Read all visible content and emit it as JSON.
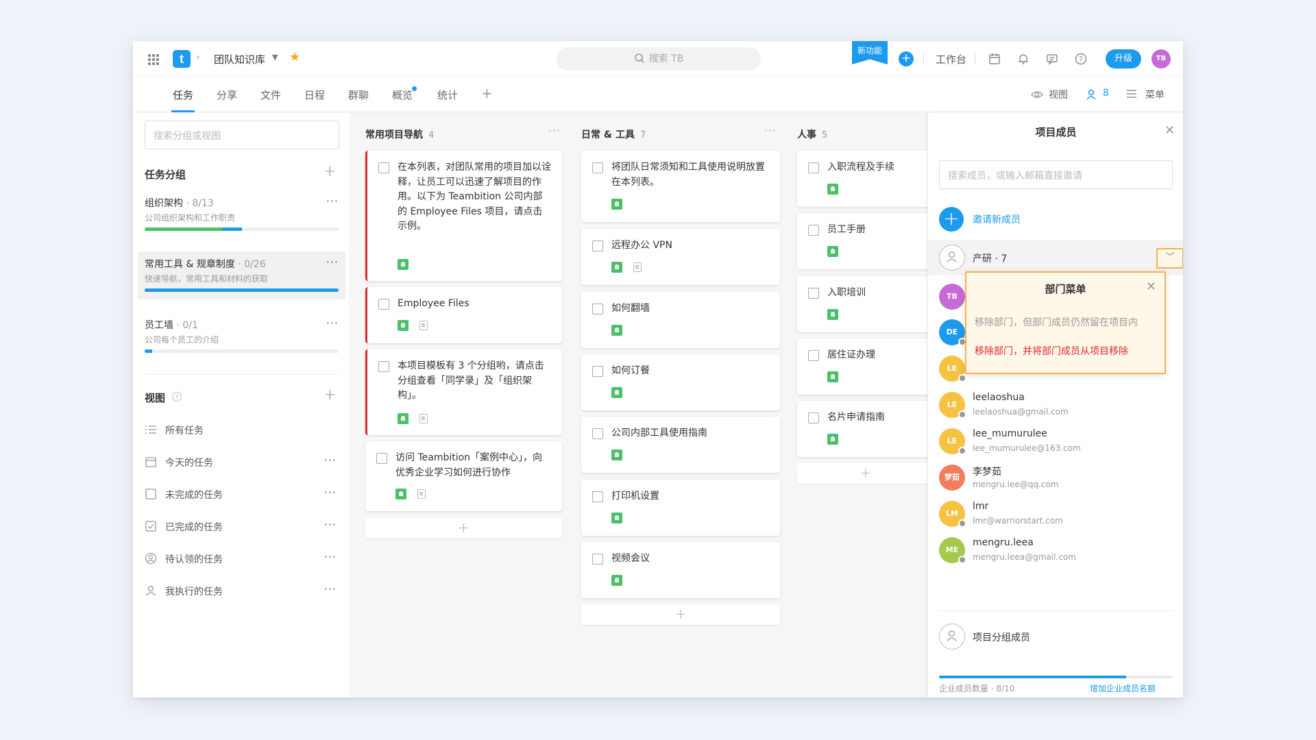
{
  "header": {
    "project_title": "团队知识库",
    "crumb_sep": "›",
    "search_placeholder": "搜索 TB",
    "new_feature": "新功能",
    "workbench": "工作台",
    "upgrade": "升级",
    "user_initials": "TB"
  },
  "tabs": [
    {
      "label": "任务"
    },
    {
      "label": "分享"
    },
    {
      "label": "文件"
    },
    {
      "label": "日程"
    },
    {
      "label": "群聊"
    },
    {
      "label": "概览"
    },
    {
      "label": "统计"
    }
  ],
  "tab_right": {
    "view": "视图",
    "members_count": "8",
    "menu": "菜单"
  },
  "sidebar": {
    "search_placeholder": "搜索分组或视图",
    "groups_title": "任务分组",
    "groups": [
      {
        "name": "组织架构",
        "count": "· 8/13",
        "desc": "公司组织架构和工作职责",
        "progress": 0.5
      },
      {
        "name": "常用工具 & 规章制度",
        "count": "· 0/26",
        "desc": "快速导航，常用工具和材料的获取",
        "progress": 1.0
      },
      {
        "name": "员工墙",
        "count": "· 0/1",
        "desc": "公司每个员工的介绍",
        "progress": 0.04
      }
    ],
    "views_title": "视图",
    "views": [
      {
        "label": "所有任务",
        "icon": "list-icon"
      },
      {
        "label": "今天的任务",
        "icon": "calendar-icon"
      },
      {
        "label": "未完成的任务",
        "icon": "checkbox-icon"
      },
      {
        "label": "已完成的任务",
        "icon": "checked-icon"
      },
      {
        "label": "待认领的任务",
        "icon": "user-circle-icon"
      },
      {
        "label": "我执行的任务",
        "icon": "user-icon"
      }
    ]
  },
  "board": {
    "columns": [
      {
        "title": "常用项目导航",
        "count": "4",
        "cards": [
          {
            "text": "在本列表，对团队常用的项目加以诠释，让员工可以迅速了解项目的作用。以下为 Teambition 公司内部的 Employee Files 项目，请点击示例。"
          },
          {
            "text": "Employee Files"
          },
          {
            "text": "本项目模板有 3 个分组哟，请点击分组查看「同学录」及「组织架构」。"
          },
          {
            "text": "访问 Teambition「案例中心」，向优秀企业学习如何进行协作"
          }
        ]
      },
      {
        "title": "日常 & 工具",
        "count": "7",
        "cards": [
          {
            "text": "将团队日常须知和工具使用说明放置在本列表。"
          },
          {
            "text": "远程办公 VPN"
          },
          {
            "text": "如何翻墙"
          },
          {
            "text": "如何订餐"
          },
          {
            "text": "公司内部工具使用指南"
          },
          {
            "text": "打印机设置"
          },
          {
            "text": "视频会议"
          }
        ]
      },
      {
        "title": "人事",
        "count": "5",
        "cards": [
          {
            "text": "入职流程及手续"
          },
          {
            "text": "员工手册"
          },
          {
            "text": "入职培训"
          },
          {
            "text": "居住证办理"
          },
          {
            "text": "名片申请指南"
          }
        ]
      }
    ]
  },
  "panel": {
    "title": "项目成员",
    "search_placeholder": "搜索成员，或输入邮箱直接邀请",
    "invite": "邀请新成员",
    "dept": "产研 · 7",
    "members": [
      {
        "initials": "TB",
        "color": "#c869d8",
        "name": "",
        "email": ""
      },
      {
        "initials": "DE",
        "color": "#1b9aee",
        "name": "",
        "email": ""
      },
      {
        "initials": "LE",
        "color": "#f5c242",
        "name": "",
        "email": ""
      },
      {
        "initials": "LE",
        "color": "#f5c242",
        "name": "leelaoshua",
        "email": "leelaoshua@gmail.com"
      },
      {
        "initials": "LE",
        "color": "#f5c242",
        "name": "lee_mumurulee",
        "email": "lee_mumurulee@163.com"
      },
      {
        "initials": "梦茹",
        "color": "#f07d5e",
        "name": "李梦茹",
        "email": "mengru.lee@qq.com"
      },
      {
        "initials": "LM",
        "color": "#f5c242",
        "name": "lmr",
        "email": "lmr@warriorstart.com"
      },
      {
        "initials": "ME",
        "color": "#a6c84c",
        "name": "mengru.leea",
        "email": "mengru.leea@gmail.com"
      }
    ],
    "subgroup": "项目分组成员",
    "quota_text": "企业成员数量 · 8/10",
    "quota_link": "增加企业成员名额",
    "quota_fraction": 0.8
  },
  "popup": {
    "title": "部门菜单",
    "option1": "移除部门，但部门成员仍然留在项目内",
    "option2": "移除部门，并将部门成员从项目移除"
  },
  "colors": {
    "accent": "#1b9aee",
    "danger": "#e0282e",
    "highlight": "#f5b14a",
    "tag": "#4cc067"
  }
}
